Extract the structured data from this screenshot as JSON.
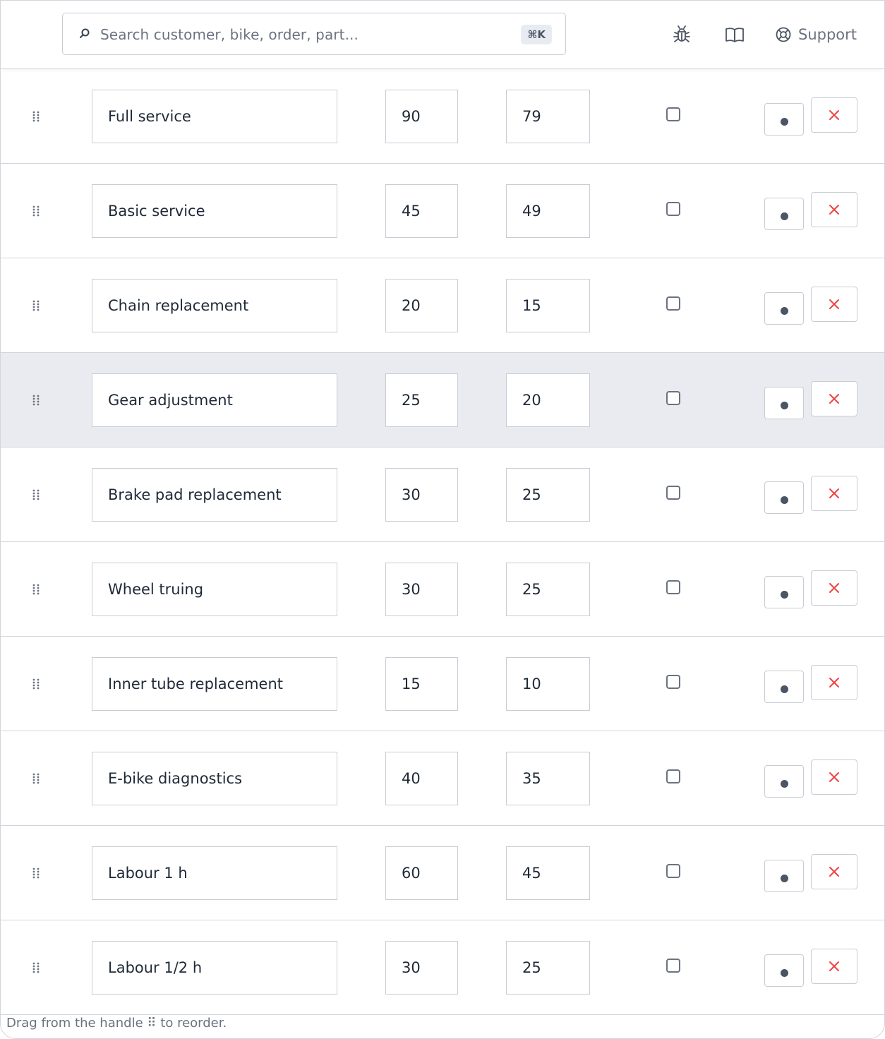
{
  "topbar": {
    "search_placeholder": "Search customer, bike, order, part...",
    "shortcut": "⌘K",
    "support_label": "Support"
  },
  "rows": [
    {
      "name": "Full service",
      "a": "90",
      "b": "79",
      "highlighted": false
    },
    {
      "name": "Basic service",
      "a": "45",
      "b": "49",
      "highlighted": false
    },
    {
      "name": "Chain replacement",
      "a": "20",
      "b": "15",
      "highlighted": false
    },
    {
      "name": "Gear adjustment",
      "a": "25",
      "b": "20",
      "highlighted": true
    },
    {
      "name": "Brake pad replacement",
      "a": "30",
      "b": "25",
      "highlighted": false
    },
    {
      "name": "Wheel truing",
      "a": "30",
      "b": "25",
      "highlighted": false
    },
    {
      "name": "Inner tube replacement",
      "a": "15",
      "b": "10",
      "highlighted": false
    },
    {
      "name": "E-bike diagnostics",
      "a": "40",
      "b": "35",
      "highlighted": false
    },
    {
      "name": "Labour 1 h",
      "a": "60",
      "b": "45",
      "highlighted": false
    },
    {
      "name": "Labour 1/2 h",
      "a": "30",
      "b": "25",
      "highlighted": false
    }
  ],
  "footer": {
    "hint": "Drag from the handle ⠿ to reorder."
  },
  "colors": {
    "accent_delete": "#ef4444",
    "row_highlight": "#e9ebf0"
  }
}
